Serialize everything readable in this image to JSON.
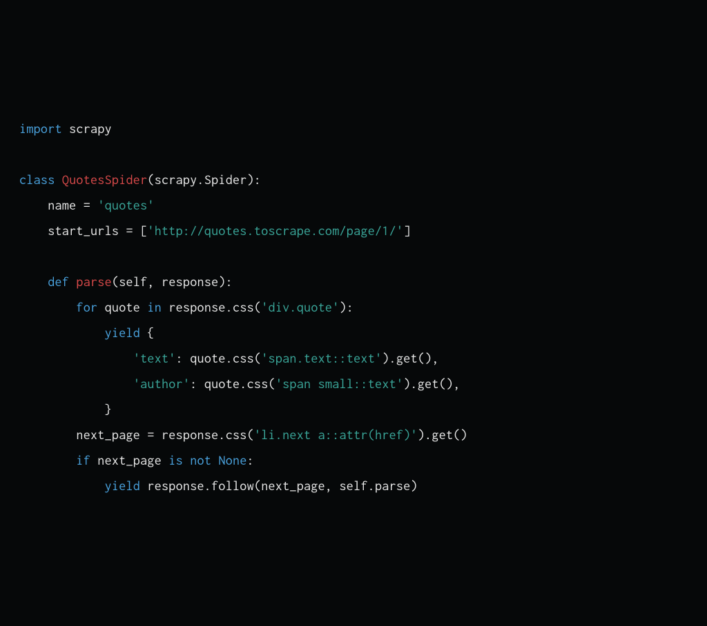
{
  "code": {
    "l1": {
      "import": "import",
      "scrapy": "scrapy"
    },
    "l3": {
      "class": "class",
      "name": "QuotesSpider",
      "open": "(scrapy.Spider):"
    },
    "l4": {
      "lhs": "    name = ",
      "str": "'quotes'"
    },
    "l5": {
      "lhs": "    start_urls = [",
      "str": "'http://quotes.toscrape.com/page/1/'",
      "close": "]"
    },
    "l7": {
      "def": "    def",
      "name": " parse",
      "sig": "(self, response):"
    },
    "l8": {
      "for": "        for",
      "var": " quote ",
      "in": "in",
      "expr": " response.css(",
      "str": "'div.quote'",
      "close": "):"
    },
    "l9": {
      "yield": "            yield",
      "brace": " {"
    },
    "l10": {
      "indent": "                ",
      "key": "'text'",
      "mid": ": quote.css(",
      "arg": "'span.text::text'",
      "end": ").get(),"
    },
    "l11": {
      "indent": "                ",
      "key": "'author'",
      "mid": ": quote.css(",
      "arg": "'span small::text'",
      "end": ").get(),"
    },
    "l12": {
      "brace": "            }"
    },
    "l13": {
      "lhs": "        next_page = response.css(",
      "str": "'li.next a::attr(href)'",
      "end": ").get()"
    },
    "l14": {
      "if": "        if",
      "var": " next_page ",
      "is": "is",
      "sp": " ",
      "not": "not",
      "sp2": " ",
      "none": "None",
      "colon": ":"
    },
    "l15": {
      "yield": "            yield",
      "rest": " response.follow(next_page, self.parse)"
    }
  }
}
